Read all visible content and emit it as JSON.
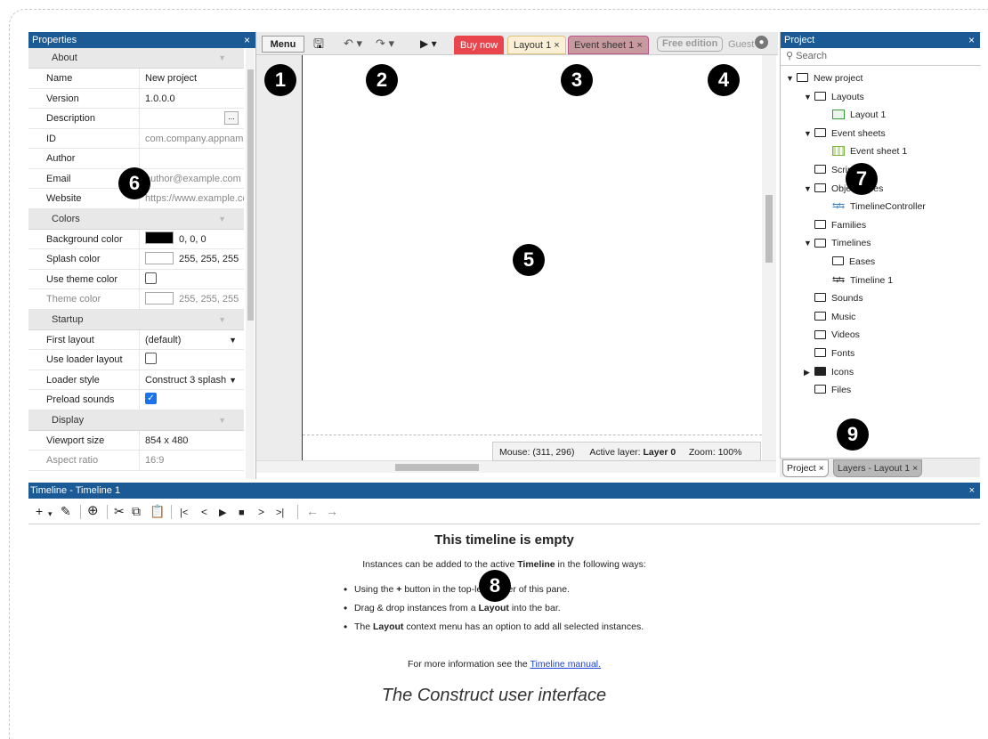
{
  "frame_caption": "The Construct user interface",
  "properties": {
    "title": "Properties",
    "close": "×",
    "sections": [
      {
        "label": "About",
        "rows": [
          {
            "key": "Name",
            "value": "New project"
          },
          {
            "key": "Version",
            "value": "1.0.0.0"
          },
          {
            "key": "Description",
            "value": "",
            "button": "..."
          },
          {
            "key": "ID",
            "value": "com.company.appname"
          },
          {
            "key": "Author",
            "value": ""
          },
          {
            "key": "Email",
            "value": "author@example.com"
          },
          {
            "key": "Website",
            "value": "https://www.example.com"
          }
        ]
      },
      {
        "label": "Colors",
        "rows": [
          {
            "key": "Background color",
            "value": "0, 0, 0",
            "swatch": "#000000"
          },
          {
            "key": "Splash color",
            "value": "255, 255, 255",
            "swatch": "#ffffff"
          },
          {
            "key": "Use theme color",
            "value": "",
            "checkbox": false
          },
          {
            "key": "Theme color",
            "value": "255, 255, 255",
            "swatch": "#ffffff"
          }
        ]
      },
      {
        "label": "Startup",
        "rows": [
          {
            "key": "First layout",
            "value": "(default)"
          },
          {
            "key": "Use loader layout",
            "value": "",
            "checkbox": false
          },
          {
            "key": "Loader style",
            "value": "Construct 3 splash"
          },
          {
            "key": "Preload sounds",
            "value": "",
            "checkbox": true
          }
        ]
      },
      {
        "label": "Display",
        "rows": [
          {
            "key": "Viewport size",
            "value": "854 x 480"
          },
          {
            "key": "Aspect ratio",
            "value": "16:9"
          }
        ]
      }
    ]
  },
  "toolbar": {
    "menu": "Menu",
    "buy_now": "Buy now",
    "tab_layout": "Layout 1",
    "tab_events": "Event sheet 1",
    "free_edition": "Free edition",
    "guest": "Guest",
    "tab_close": "×"
  },
  "status": {
    "mouse_label": "Mouse:",
    "mouse_value": "(311, 296)",
    "layer_label": "Active layer:",
    "layer_value": "Layer 0",
    "zoom_label": "Zoom:",
    "zoom_value": "100%"
  },
  "project": {
    "title": "Project",
    "close": "×",
    "search_placeholder": "Search",
    "tree": [
      {
        "label": "New project",
        "level": 0,
        "kind": "folder",
        "expanded": true
      },
      {
        "label": "Layouts",
        "level": 1,
        "kind": "folder",
        "expanded": true
      },
      {
        "label": "Layout 1",
        "level": 2,
        "kind": "layout"
      },
      {
        "label": "Event sheets",
        "level": 1,
        "kind": "folder",
        "expanded": true
      },
      {
        "label": "Event sheet 1",
        "level": 2,
        "kind": "eventsheet"
      },
      {
        "label": "Scripts",
        "level": 1,
        "kind": "folder"
      },
      {
        "label": "Object types",
        "level": 1,
        "kind": "folder",
        "expanded": true
      },
      {
        "label": "TimelineController",
        "level": 2,
        "kind": "timeline-obj"
      },
      {
        "label": "Families",
        "level": 1,
        "kind": "folder"
      },
      {
        "label": "Timelines",
        "level": 1,
        "kind": "folder",
        "expanded": true
      },
      {
        "label": "Eases",
        "level": 2,
        "kind": "folder"
      },
      {
        "label": "Timeline 1",
        "level": 2,
        "kind": "timeline"
      },
      {
        "label": "Sounds",
        "level": 1,
        "kind": "folder"
      },
      {
        "label": "Music",
        "level": 1,
        "kind": "folder"
      },
      {
        "label": "Videos",
        "level": 1,
        "kind": "folder"
      },
      {
        "label": "Fonts",
        "level": 1,
        "kind": "folder"
      },
      {
        "label": "Icons",
        "level": 1,
        "kind": "folder-filled",
        "collapsed": true
      },
      {
        "label": "Files",
        "level": 1,
        "kind": "folder"
      }
    ],
    "tab_project": "Project",
    "tab_layers": "Layers - Layout 1"
  },
  "timeline": {
    "title": "Timeline - Timeline 1",
    "close": "×",
    "heading": "This timeline is empty",
    "intro_prefix": "Instances can be added to the active ",
    "intro_bold": "Timeline",
    "intro_suffix": " in the following ways:",
    "bullets": [
      {
        "pre": "Using the ",
        "bold": "+",
        "post": " button in the top-left corner of this pane."
      },
      {
        "pre": "Drag & drop instances from a ",
        "bold": "Layout",
        "post": " into the bar."
      },
      {
        "pre": "The ",
        "bold": "Layout",
        "post": " context menu has an option to add all selected instances."
      }
    ],
    "more_prefix": "For more information see the ",
    "more_link": "Timeline manual."
  },
  "badges": [
    "1",
    "2",
    "3",
    "4",
    "5",
    "6",
    "7",
    "8",
    "9"
  ]
}
